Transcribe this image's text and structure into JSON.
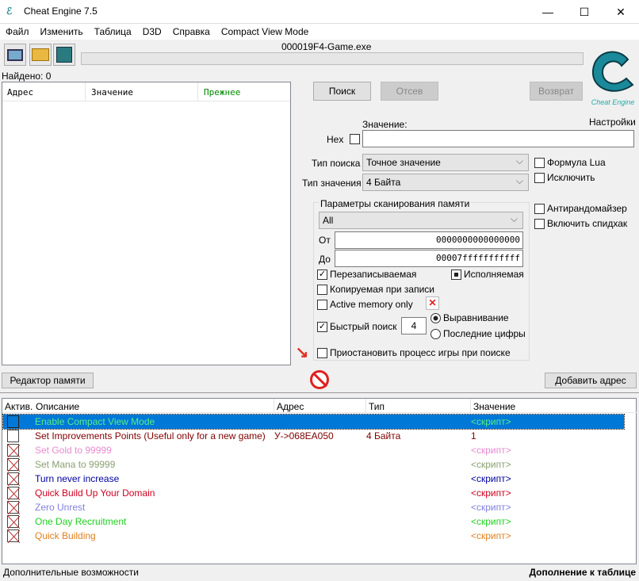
{
  "window": {
    "title": "Cheat Engine 7.5",
    "minimize": "—",
    "maximize": "☐",
    "close": "✕"
  },
  "menu": [
    "Файл",
    "Изменить",
    "Таблица",
    "D3D",
    "Справка",
    "Compact View Mode"
  ],
  "process_name": "000019F4-Game.exe",
  "found_label": "Найдено: 0",
  "results_headers": [
    "Адрес",
    "Значение",
    "Прежнее"
  ],
  "buttons": {
    "scan": "Поиск",
    "next_scan": "Отсев",
    "undo": "Возврат",
    "memory_view": "Редактор памяти",
    "add_address": "Добавить адрес"
  },
  "logo_text": "Cheat Engine",
  "settings_label": "Настройки",
  "value_label": "Значение:",
  "hex_label": "Hex",
  "value_input": "",
  "scan_type_label": "Тип поиска",
  "scan_type": "Точное значение",
  "value_type_label": "Тип значения",
  "value_type": "4 Байта",
  "lua_formula": "Формула Lua",
  "not_label": "Исключить",
  "unrandomizer": "Антирандомайзер",
  "speedhack": "Включить спидхак",
  "mem_scan": {
    "title": "Параметры сканирования памяти",
    "region": "All",
    "from_label": "От",
    "from": "0000000000000000",
    "to_label": "До",
    "to": "00007fffffffffff",
    "writable": "Перезаписываемая",
    "executable": "Исполняемая",
    "copy_on_write": "Копируемая при записи",
    "active_memory": "Active memory only",
    "fast_scan": "Быстрый поиск",
    "fast_scan_value": "4",
    "alignment": "Выравнивание",
    "last_digits": "Последние цифры",
    "pause": "Приостановить процесс игры при поиске"
  },
  "table": {
    "headers": [
      "Актив.",
      "Описание",
      "Адрес",
      "Тип",
      "Значение"
    ],
    "rows": [
      {
        "desc": "Enable Compact View Mode",
        "addr": "",
        "type": "",
        "value": "<скрипт>",
        "color": "#55ee88",
        "active": false,
        "selected": true,
        "script": true
      },
      {
        "desc": "Set Improvements Points (Useful only for a new game)",
        "addr": "У->068EA050",
        "type": "4 Байта",
        "value": "1",
        "color": "#800000",
        "active": false,
        "selected": false,
        "script": false
      },
      {
        "desc": "Set Gold to 99999",
        "addr": "",
        "type": "",
        "value": "<скрипт>",
        "color": "#e88ad0",
        "active": false,
        "script": true
      },
      {
        "desc": "Set Mana to 99999",
        "addr": "",
        "type": "",
        "value": "<скрипт>",
        "color": "#8aa070",
        "active": false,
        "script": true
      },
      {
        "desc": "Turn never increase",
        "addr": "",
        "type": "",
        "value": "<скрипт>",
        "color": "#0000a0",
        "active": false,
        "script": true
      },
      {
        "desc": "Quick Build Up Your Domain",
        "addr": "",
        "type": "",
        "value": "<скрипт>",
        "color": "#d00020",
        "active": false,
        "script": true
      },
      {
        "desc": "Zero Unrest",
        "addr": "",
        "type": "",
        "value": "<скрипт>",
        "color": "#8080e0",
        "active": false,
        "script": true
      },
      {
        "desc": "One Day Recruitment",
        "addr": "",
        "type": "",
        "value": "<скрипт>",
        "color": "#20d020",
        "active": false,
        "script": true
      },
      {
        "desc": "Quick Building",
        "addr": "",
        "type": "",
        "value": "<скрипт>",
        "color": "#e08020",
        "active": false,
        "script": true
      }
    ]
  },
  "status": {
    "left": "Дополнительные возможности",
    "right": "Дополнение к таблице"
  }
}
